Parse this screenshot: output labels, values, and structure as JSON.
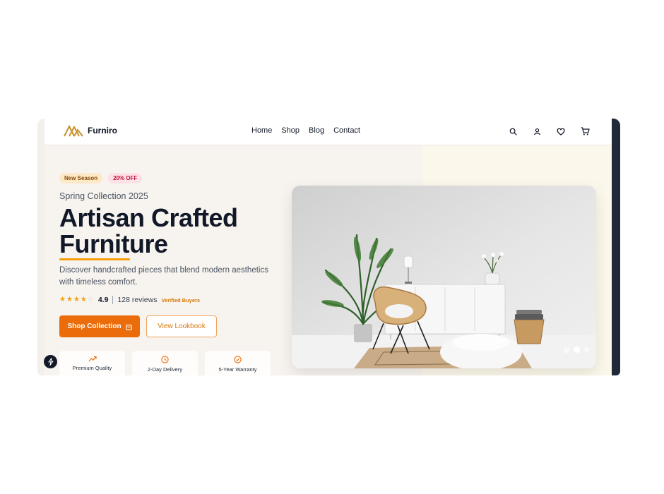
{
  "header": {
    "logo_text": "Furniro",
    "nav": [
      "Home",
      "Shop",
      "Blog",
      "Contact"
    ],
    "icons": [
      "search-icon",
      "user-icon",
      "heart-icon",
      "cart-icon"
    ]
  },
  "hero": {
    "badges": [
      "New Season",
      "20% OFF"
    ],
    "subtitle": "Spring Collection 2025",
    "headline_line1": "Artisan Crafted",
    "headline_line2": "Furniture",
    "description": "Discover handcrafted pieces that blend modern aesthetics with timeless comfort.",
    "rating": {
      "stars_filled": 4,
      "stars_total": 5,
      "value": "4.9",
      "reviews": "128 reviews",
      "verified": "Verified Buyers"
    },
    "primary_button": "Shop Collection",
    "secondary_button": "View Lookbook",
    "features": [
      {
        "icon": "trending-up-icon",
        "label": "Premium Quality"
      },
      {
        "icon": "clock-icon",
        "label": "2-Day Delivery"
      },
      {
        "icon": "check-circle-icon",
        "label": "5-Year Warranty"
      }
    ],
    "carousel": {
      "slides": 3,
      "active_slide": 2
    }
  },
  "colors": {
    "accent": "#ea6c0a",
    "star": "#f59e0b",
    "text_dark": "#111827",
    "background": "#f7f3ee"
  }
}
